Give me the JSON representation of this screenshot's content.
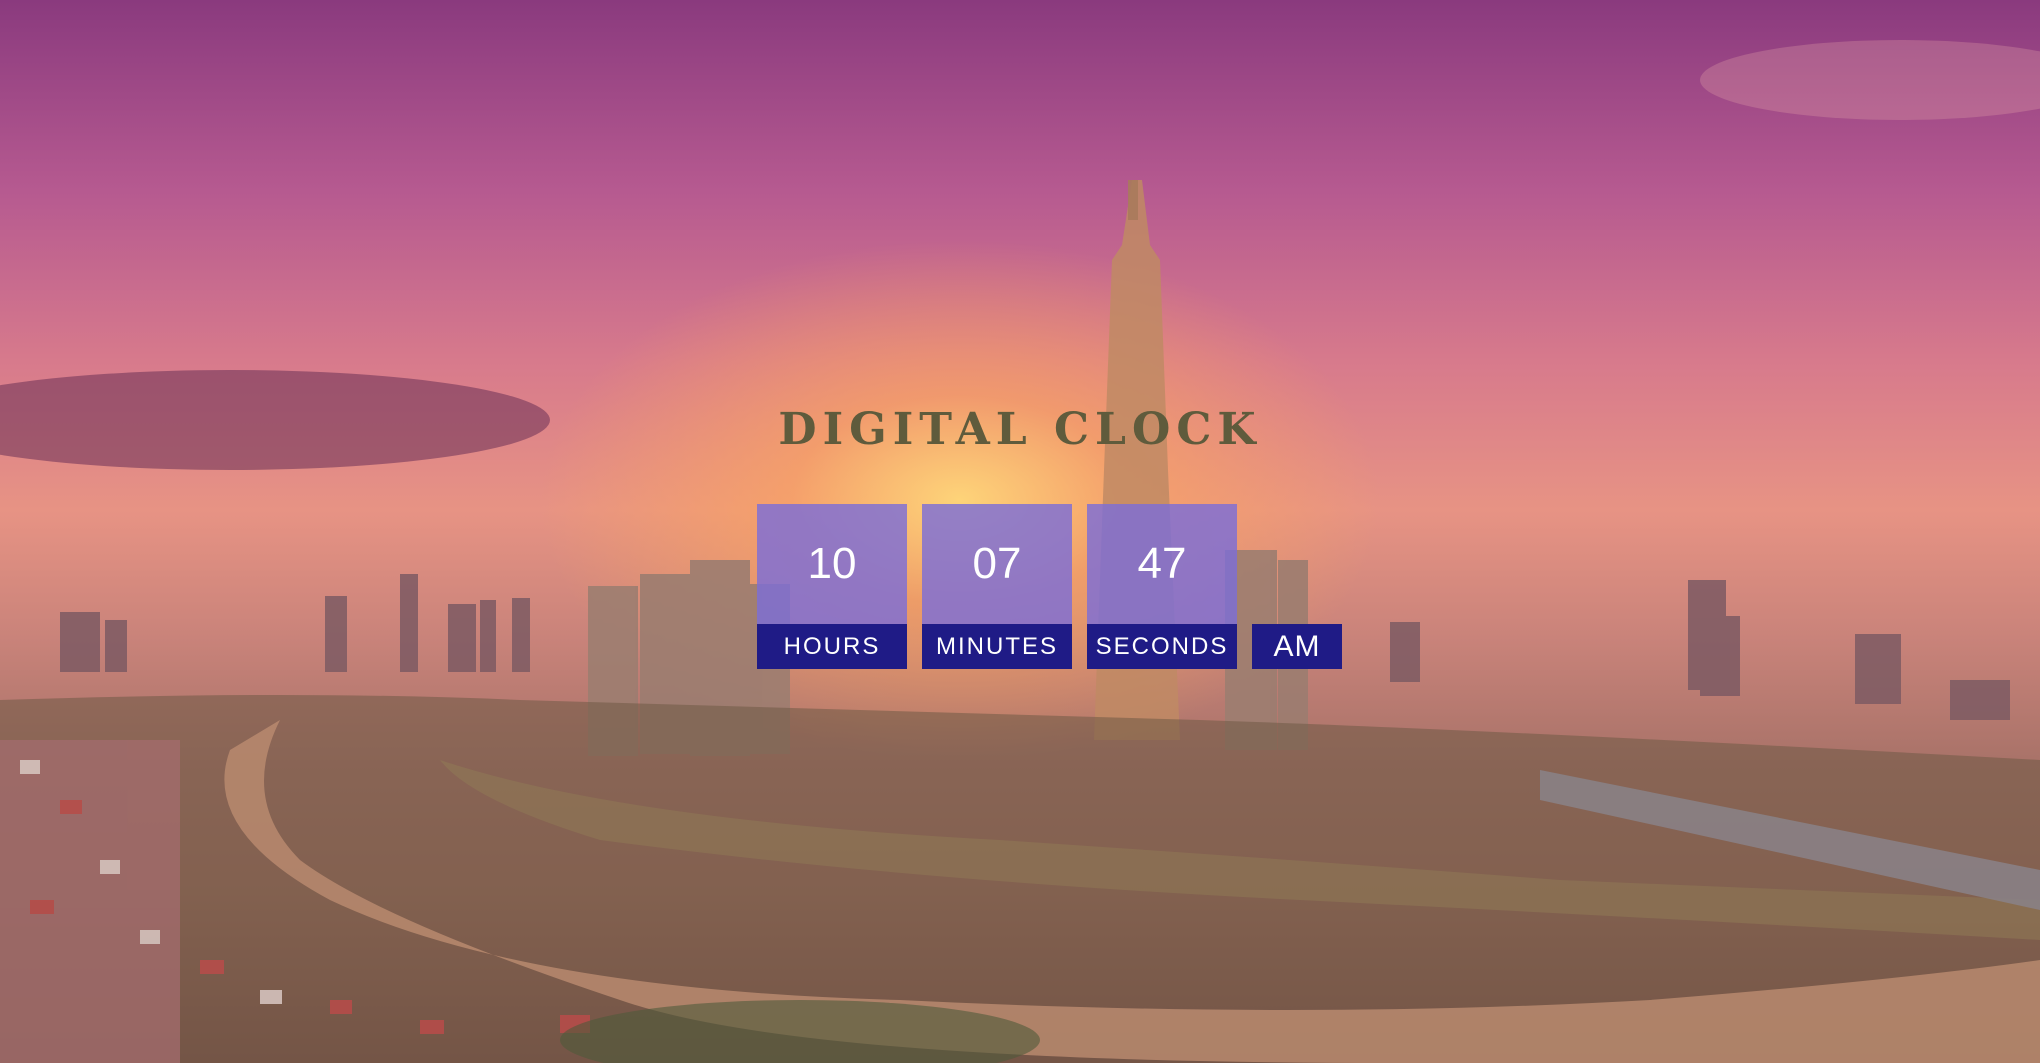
{
  "page": {
    "title": "DIGITAL CLOCK"
  },
  "clock": {
    "hours": "10",
    "minutes": "07",
    "seconds": "47",
    "hours_label": "HOURS",
    "minutes_label": "MINUTES",
    "seconds_label": "SECONDS",
    "period": "AM"
  },
  "colors": {
    "title": "#5f5b3c",
    "tile": "#7c6ed7",
    "label_bar": "#1f1b86"
  }
}
